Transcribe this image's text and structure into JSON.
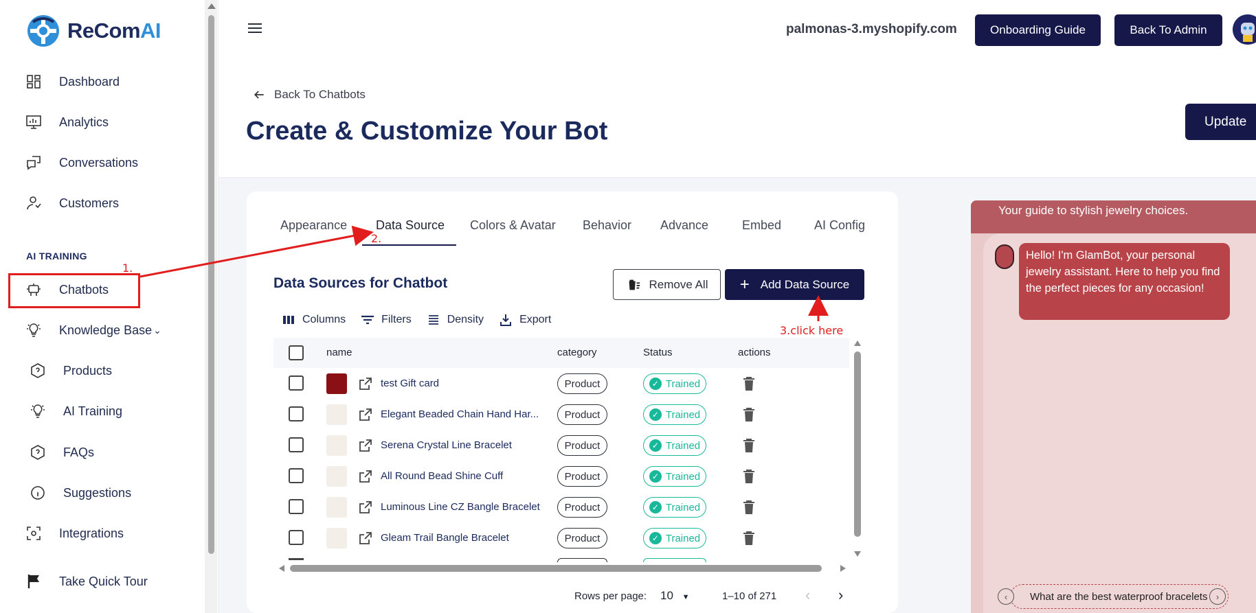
{
  "brand": {
    "name_main": "ReCom",
    "name_accent": "AI"
  },
  "sidebar": {
    "items": [
      {
        "label": "Dashboard",
        "icon": "dashboard-icon"
      },
      {
        "label": "Analytics",
        "icon": "monitor-chart-icon"
      },
      {
        "label": "Conversations",
        "icon": "chat-bubbles-icon"
      },
      {
        "label": "Customers",
        "icon": "user-icon"
      }
    ],
    "section_label": "AI TRAINING",
    "training_items": [
      {
        "label": "Chatbots",
        "icon": "robot-icon"
      },
      {
        "label": "Knowledge Base",
        "icon": "lightbulb-icon"
      },
      {
        "label": "Products",
        "icon": "hexagon-question-icon"
      },
      {
        "label": "AI Training",
        "icon": "lightbulb-icon"
      },
      {
        "label": "FAQs",
        "icon": "hexagon-question-icon"
      },
      {
        "label": "Suggestions",
        "icon": "info-circle-icon"
      },
      {
        "label": "Integrations",
        "icon": "focus-icon"
      },
      {
        "label": "Take Quick Tour",
        "icon": "flag-icon"
      }
    ]
  },
  "header": {
    "store": "palmonas-3.myshopify.com",
    "onboarding_label": "Onboarding Guide",
    "back_admin_label": "Back To Admin"
  },
  "page": {
    "back_label": "Back To Chatbots",
    "title": "Create & Customize Your Bot",
    "update_label": "Update"
  },
  "tabs": [
    "Appearance",
    "Data Source",
    "Colors & Avatar",
    "Behavior",
    "Advance",
    "Embed",
    "AI Config"
  ],
  "data_source": {
    "title": "Data Sources for Chatbot",
    "remove_all_label": "Remove All",
    "add_label": "Add Data Source",
    "toolbar": [
      "Columns",
      "Filters",
      "Density",
      "Export"
    ],
    "columns": [
      "name",
      "category",
      "Status",
      "actions"
    ],
    "rows": [
      {
        "name": "test Gift card",
        "category": "Product",
        "status": "Trained"
      },
      {
        "name": "Elegant Beaded Chain Hand Har...",
        "category": "Product",
        "status": "Trained"
      },
      {
        "name": "Serena Crystal Line Bracelet",
        "category": "Product",
        "status": "Trained"
      },
      {
        "name": "All Round Bead Shine Cuff",
        "category": "Product",
        "status": "Trained"
      },
      {
        "name": "Luminous Line CZ Bangle Bracelet",
        "category": "Product",
        "status": "Trained"
      },
      {
        "name": "Gleam Trail Bangle Bracelet",
        "category": "Product",
        "status": "Trained"
      }
    ],
    "pager": {
      "rows_label": "Rows per page:",
      "rows_value": "10",
      "range": "1–10 of 271"
    }
  },
  "chat": {
    "subtitle": "Your guide to stylish jewelry choices.",
    "message": "Hello! I'm GlamBot, your personal jewelry assistant. Here to help you find the perfect pieces for any occasion!",
    "suggestion": "What are the best waterproof bracelets"
  },
  "annotations": {
    "step1": "1.",
    "step2": "2.",
    "step3": "3.click here"
  },
  "colors": {
    "primary": "#17184a",
    "accent": "#2f8fd8",
    "trained": "#18b89a",
    "annotation": "#e11d1d",
    "chat": "#b84449"
  }
}
